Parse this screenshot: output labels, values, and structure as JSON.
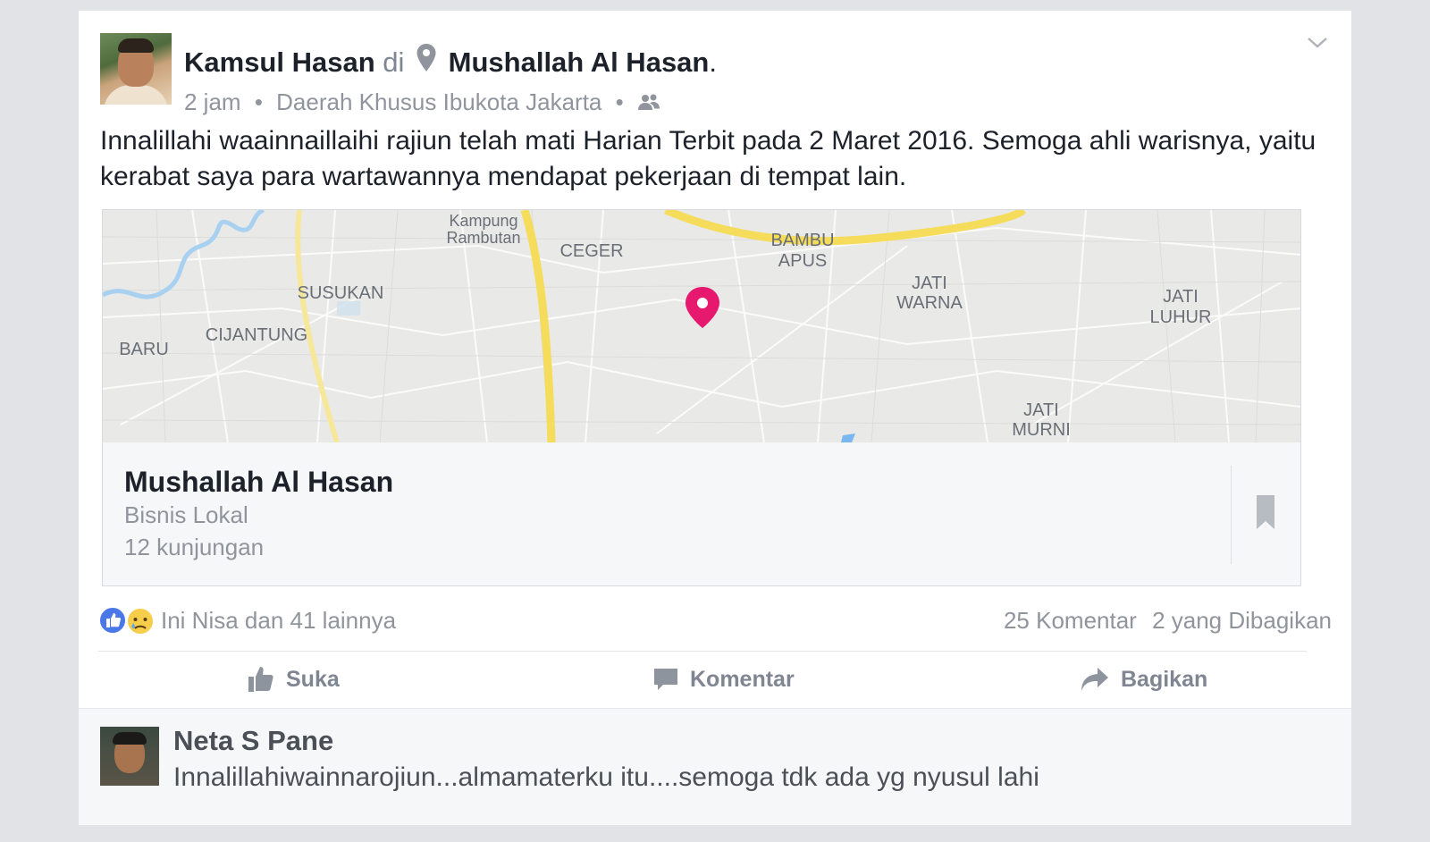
{
  "post": {
    "author": "Kamsul Hasan",
    "at_word": "di",
    "location": "Mushallah Al Hasan",
    "time": "2 jam",
    "region": "Daerah Khusus Ibukota Jakarta",
    "privacy_icon": "friends-icon",
    "text": "Innalillahi waainnaillaihi rajiun telah mati Harian Terbit pada 2 Maret 2016. Semoga ahli warisnya, yaitu kerabat saya para wartawannya mendapat pekerjaan di tempat lain."
  },
  "map": {
    "labels": [
      {
        "id": "kampung-rambutan",
        "lines": [
          "Kampung",
          "Rambutan"
        ]
      },
      {
        "id": "ceger",
        "lines": [
          "CEGER"
        ]
      },
      {
        "id": "bambu-apus",
        "lines": [
          "BAMBU",
          "APUS"
        ]
      },
      {
        "id": "susukan",
        "lines": [
          "SUSUKAN"
        ]
      },
      {
        "id": "jati-warna",
        "lines": [
          "JATI",
          "WARNA"
        ]
      },
      {
        "id": "jati-luhur",
        "lines": [
          "JATI",
          "LUHUR"
        ]
      },
      {
        "id": "baru",
        "lines": [
          "BARU"
        ]
      },
      {
        "id": "cijantung",
        "lines": [
          "CIJANTUNG"
        ]
      },
      {
        "id": "jati-murni",
        "lines": [
          "JATI",
          "MURNI"
        ]
      }
    ],
    "pin_color": "#e6196e"
  },
  "place": {
    "name": "Mushallah Al Hasan",
    "category": "Bisnis Lokal",
    "visits": "12 kunjungan"
  },
  "reactions": {
    "summary": "Ini Nisa dan 41 lainnya",
    "comments_count": "25 Komentar",
    "shares_count": "2 yang Dibagikan"
  },
  "actions": {
    "like": "Suka",
    "comment": "Komentar",
    "share": "Bagikan"
  },
  "comment": {
    "author": "Neta S Pane",
    "text": "Innalillahiwainnarojiun...almamaterku itu....semoga tdk ada yg nyusul lahi"
  },
  "colors": {
    "like_blue": "#4a78e8",
    "pin_pink": "#e6196e",
    "muted_text": "#90949c",
    "road_yellow": "#f5dc5b"
  }
}
